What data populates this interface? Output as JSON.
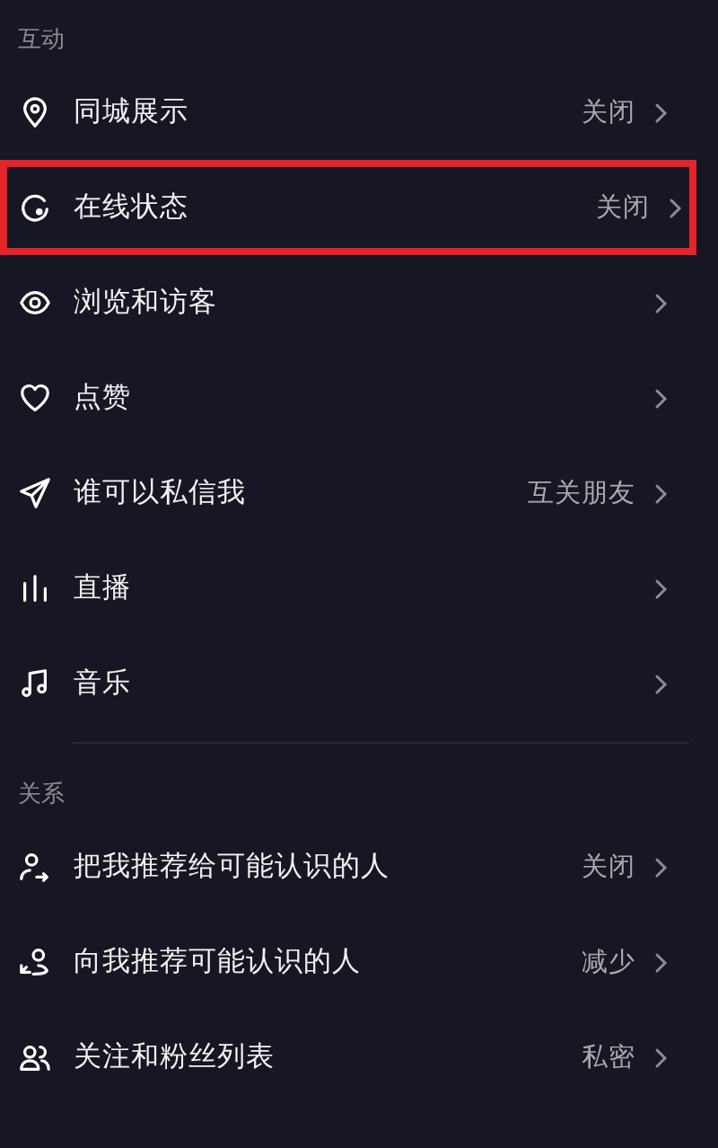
{
  "sections": [
    {
      "title": "互动",
      "rows": [
        {
          "label": "同城展示",
          "value": "关闭",
          "highlighted": false
        },
        {
          "label": "在线状态",
          "value": "关闭",
          "highlighted": true
        },
        {
          "label": "浏览和访客",
          "highlighted": false
        },
        {
          "label": "点赞",
          "highlighted": false
        },
        {
          "label": "谁可以私信我",
          "value": "互关朋友",
          "highlighted": false
        },
        {
          "label": "直播",
          "highlighted": false
        },
        {
          "label": "音乐",
          "highlighted": false
        }
      ]
    },
    {
      "title": "关系",
      "rows": [
        {
          "label": "把我推荐给可能认识的人",
          "value": "关闭",
          "highlighted": false
        },
        {
          "label": "向我推荐可能认识的人",
          "value": "减少",
          "highlighted": false
        },
        {
          "label": "关注和粉丝列表",
          "value": "私密",
          "highlighted": false
        }
      ]
    }
  ]
}
